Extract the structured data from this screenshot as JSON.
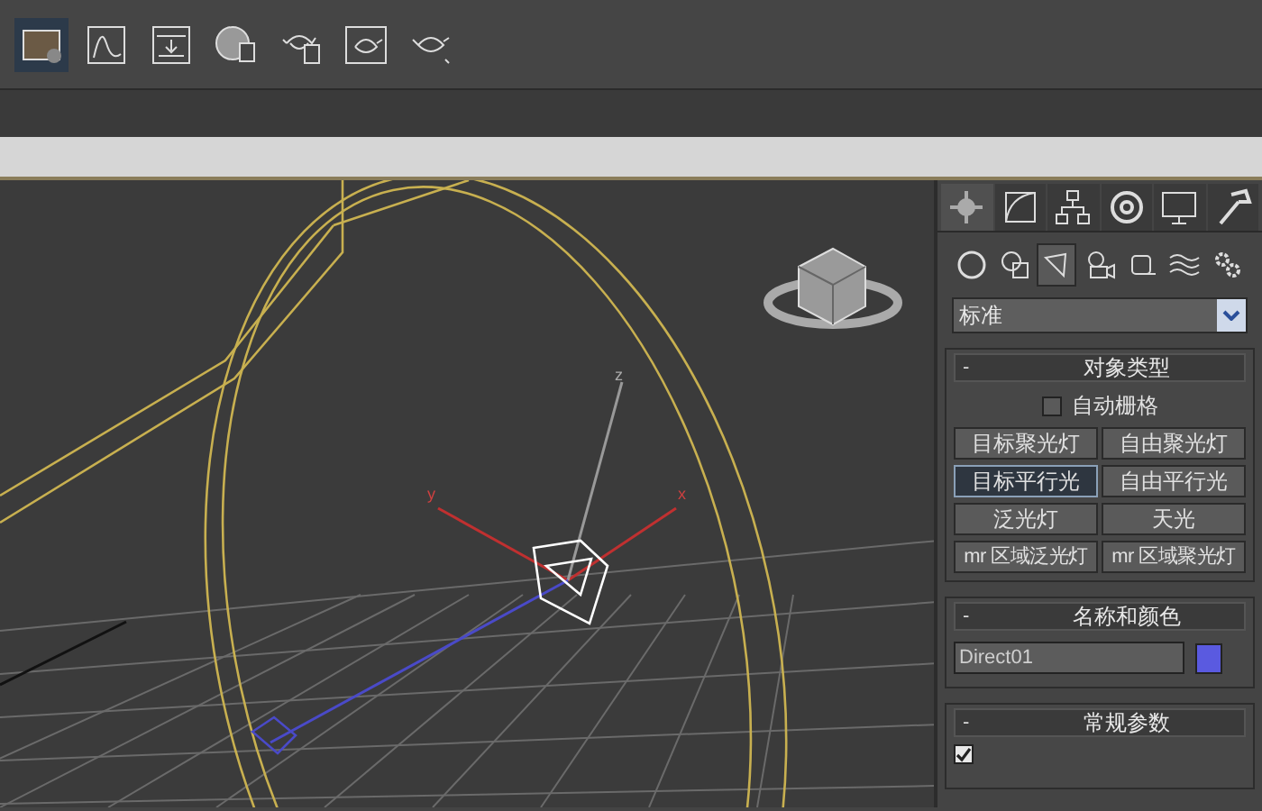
{
  "toolbar": {
    "buttons": [
      {
        "selected": true
      },
      {
        "selected": false
      },
      {
        "selected": false
      },
      {
        "selected": false
      },
      {
        "selected": false
      },
      {
        "selected": false
      },
      {
        "selected": false
      }
    ]
  },
  "viewport": {
    "axis_labels": [
      "y",
      "x",
      "z"
    ]
  },
  "command_panel": {
    "tabs": [
      {
        "selected": true
      },
      {
        "selected": false
      },
      {
        "selected": false
      },
      {
        "selected": false
      },
      {
        "selected": false
      },
      {
        "selected": false
      }
    ],
    "categories": [
      {
        "selected": false
      },
      {
        "selected": false
      },
      {
        "selected": true
      },
      {
        "selected": false
      },
      {
        "selected": false
      },
      {
        "selected": false
      },
      {
        "selected": false
      }
    ],
    "dropdown": {
      "value": "标准"
    },
    "rollouts": [
      {
        "kind": "object_type",
        "collapse": "-",
        "title": "对象类型",
        "autogrid": {
          "label": "自动栅格",
          "checked": false
        },
        "buttons": [
          {
            "label": "目标聚光灯",
            "selected": false
          },
          {
            "label": "自由聚光灯",
            "selected": false
          },
          {
            "label": "目标平行光",
            "selected": true
          },
          {
            "label": "自由平行光",
            "selected": false
          },
          {
            "label": "泛光灯",
            "selected": false
          },
          {
            "label": "天光",
            "selected": false
          },
          {
            "label": "mr 区域泛光灯",
            "selected": false
          },
          {
            "label": "mr 区域聚光灯",
            "selected": false
          }
        ]
      },
      {
        "kind": "name_color",
        "collapse": "-",
        "title": "名称和颜色",
        "name": "Direct01",
        "color": "#5a5ae0"
      },
      {
        "kind": "general",
        "collapse": "-",
        "title": "常规参数",
        "checkbox": {
          "checked": true
        }
      }
    ]
  }
}
